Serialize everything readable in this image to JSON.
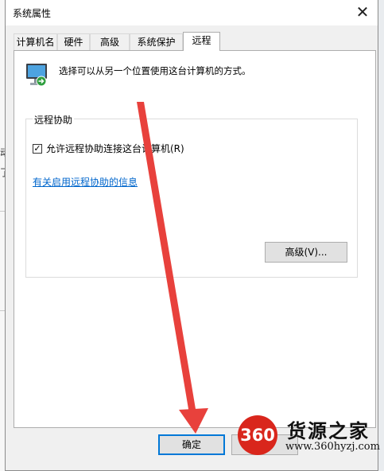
{
  "window": {
    "title": "系统属性",
    "close_glyph": "✕"
  },
  "tabs": [
    {
      "label": "计算机名",
      "active": false
    },
    {
      "label": "硬件",
      "active": false
    },
    {
      "label": "高级",
      "active": false
    },
    {
      "label": "系统保护",
      "active": false
    },
    {
      "label": "远程",
      "active": true
    }
  ],
  "remote": {
    "description": "选择可以从另一个位置使用这台计算机的方式。",
    "assistance_group_title": "远程协助",
    "allow_checkbox_label": "允许远程协助连接这台计算机(R)",
    "allow_checked": true,
    "check_glyph": "✓",
    "info_link": "有关启用远程协助的信息",
    "advanced_button": "高级(V)..."
  },
  "footer": {
    "ok_label": "确定",
    "cancel_label": ""
  },
  "background_fragments": [
    "动",
    "了"
  ],
  "watermark": {
    "badge": "360",
    "name": "货源之家",
    "url": "www.360hyzj.com"
  },
  "colors": {
    "accent": "#0078d7",
    "link": "#0066cc",
    "annotation_arrow": "#e8413c",
    "watermark_red": "#d9261c"
  }
}
